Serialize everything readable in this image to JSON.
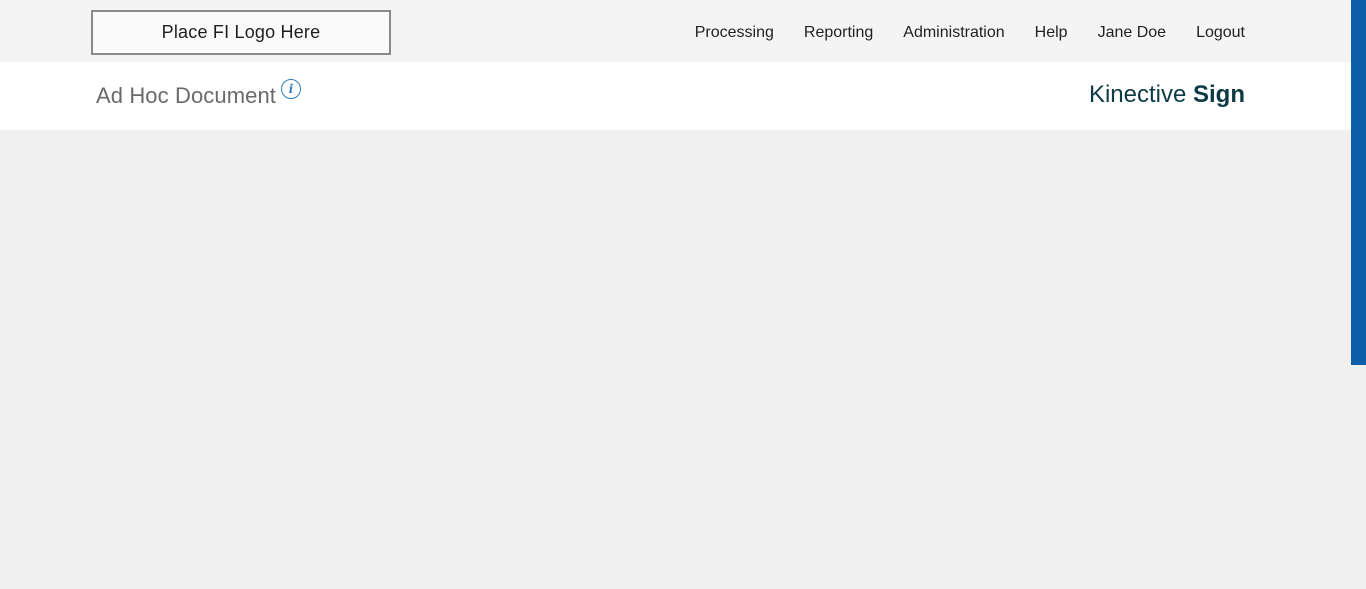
{
  "header": {
    "logo_text": "Place FI Logo Here",
    "nav": {
      "processing": "Processing",
      "reporting": "Reporting",
      "administration": "Administration",
      "help": "Help",
      "user": "Jane Doe",
      "logout": "Logout"
    }
  },
  "subheader": {
    "title": "Ad Hoc Document",
    "info_icon_glyph": "i",
    "brand": {
      "regular": "Kinective",
      "bold": "Sign"
    }
  },
  "colors": {
    "accent": "#0a5fa8",
    "brand_text": "#0d3b45",
    "info_icon": "#2f7fc0"
  },
  "icons": [
    "info-icon"
  ]
}
